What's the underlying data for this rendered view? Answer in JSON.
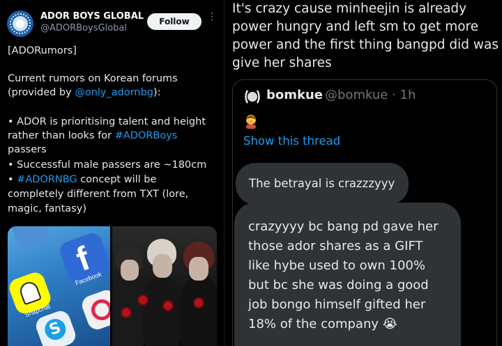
{
  "left_tweet": {
    "author": {
      "display_name": "ADOR BOYS GLOBAL",
      "handle": "@ADORBoysGlobal"
    },
    "follow_label": "Follow",
    "more_glyph": "⋮",
    "tag_line": "[ADORumors]",
    "intro_line1": "Current rumors on Korean forums",
    "intro_line2_prefix": "(provided by ",
    "intro_line2_mention": "@only_adornbg",
    "intro_line2_suffix": "):",
    "bullet1_line1": "• ADOR is prioritising talent and height",
    "bullet1_line2_prefix": "rather than looks for ",
    "bullet1_line2_hashtag": "#ADORBoys",
    "bullet1_line3": "passers",
    "bullet2": "• Successful male passers are ~180cm",
    "bullet3_line1_prefix": "• ",
    "bullet3_line1_hashtag": "#ADORNBG",
    "bullet3_line1_suffix": " concept will be",
    "bullet3_line2": "completely different from TXT (lore,",
    "bullet3_line3": "magic, fantasy)",
    "media": [
      {
        "kind": "app-icons-photo",
        "labels": [
          "Facebook",
          "Snapchat"
        ],
        "icons": [
          "facebook-icon",
          "snapchat-icon",
          "skype-icon",
          "app-icon"
        ]
      },
      {
        "kind": "group-photo",
        "icons": [
          "rose-icon"
        ]
      }
    ]
  },
  "right_post": {
    "quote_lines": [
      "It's crazy cause minheejin is already",
      "power hungry and left sm to get more",
      "power and the first thing bangpd did was",
      "give her shares"
    ],
    "quoted": {
      "display_name": "bomkue",
      "handle_time": "@bomkue · 1h",
      "emoji": "🤦",
      "show_thread": "Show this thread",
      "message1": "The betrayal is crazzzyyy",
      "message2_lines": [
        "crazyyyy bc bang pd gave her",
        "those ador shares as a GIFT",
        "like hybe used to own 100%",
        "but bc she was doing a good",
        "job bongo himself gifted her",
        "18% of the company 😭"
      ]
    }
  },
  "colors": {
    "link": "#1d9bf0",
    "background": "#000000",
    "bubble": "#2f3336",
    "muted": "#8b98a5"
  }
}
